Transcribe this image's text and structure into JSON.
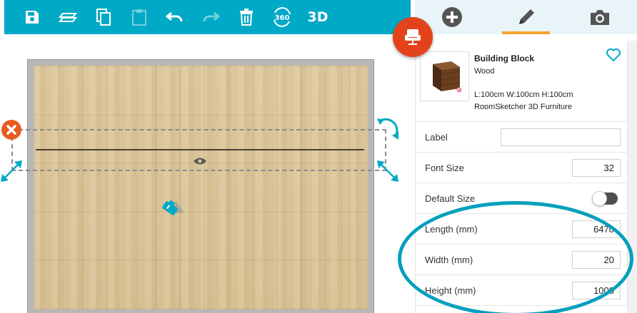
{
  "toolbar": {
    "items": [
      {
        "name": "save-icon"
      },
      {
        "name": "layers-icon"
      },
      {
        "name": "copy-icon"
      },
      {
        "name": "paste-icon",
        "disabled": true
      },
      {
        "name": "undo-icon"
      },
      {
        "name": "redo-icon",
        "disabled": true
      },
      {
        "name": "trash-icon"
      },
      {
        "name": "view-360-icon",
        "label": "360"
      },
      {
        "name": "view-3d-button",
        "label": "3D"
      }
    ],
    "color": "#00a9c6"
  },
  "panel_tabs": [
    {
      "name": "add-icon"
    },
    {
      "name": "edit-pencil-icon",
      "active": true
    },
    {
      "name": "camera-icon"
    }
  ],
  "accent_colors": {
    "tab_underline": "#f5a230",
    "fab": "#e2431b",
    "highlight": "#00a0bd"
  },
  "item": {
    "title": "Building Block",
    "material": "Wood",
    "dimensions": "L:100cm W:100cm H:100cm",
    "source": "RoomSketcher 3D Furniture"
  },
  "properties": {
    "label": {
      "label": "Label",
      "value": ""
    },
    "font_size": {
      "label": "Font Size",
      "value": "32"
    },
    "default_size": {
      "label": "Default Size",
      "value": "off"
    },
    "length": {
      "label": "Length (mm)",
      "value": "6470"
    },
    "width": {
      "label": "Width (mm)",
      "value": "20"
    },
    "height": {
      "label": "Height (mm)",
      "value": "1000"
    }
  }
}
